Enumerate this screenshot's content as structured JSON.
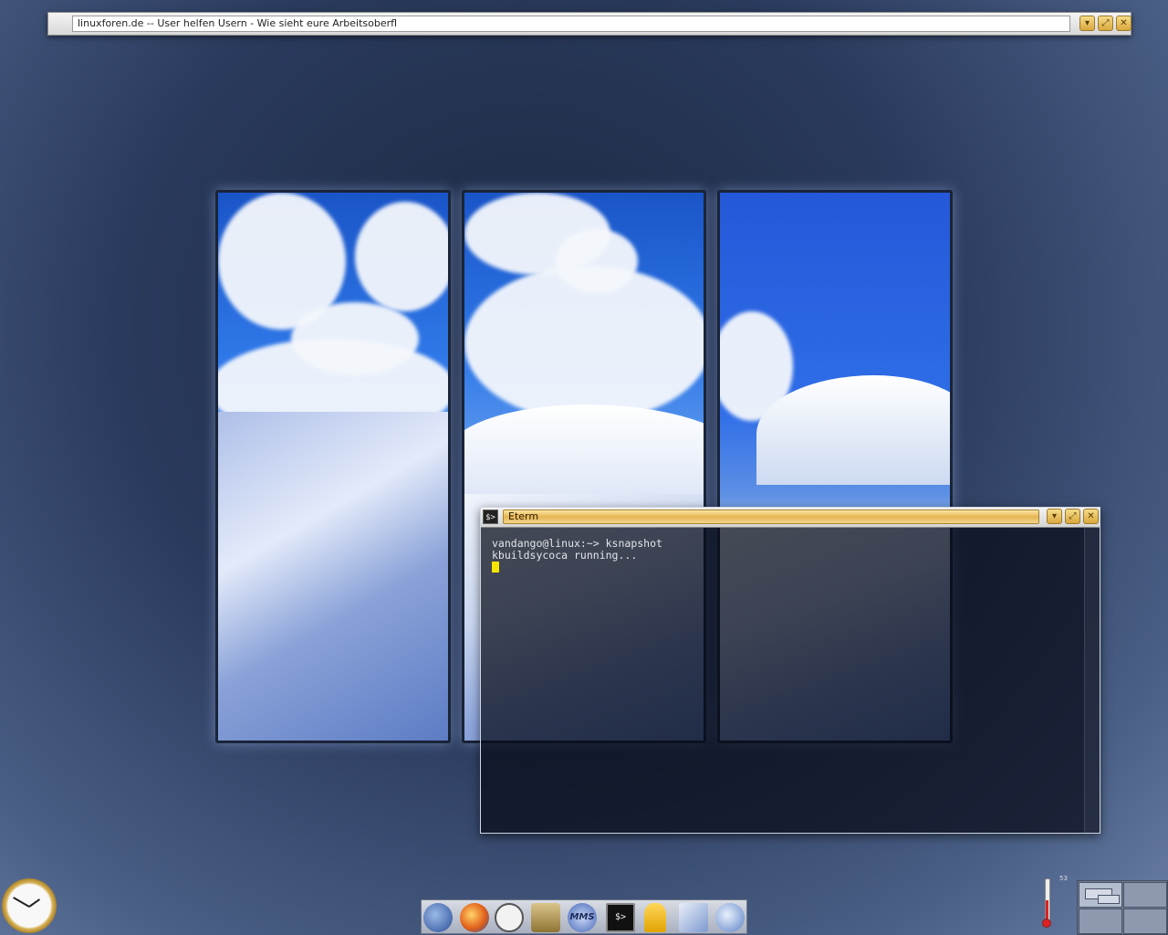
{
  "browser_window": {
    "title": "linuxforen.de -- User helfen Usern - Wie sieht eure Arbeitsoberfl",
    "minimize_icon": "chevron-down-icon",
    "maximize_icon": "maximize-icon",
    "close_icon": "close-icon"
  },
  "eterm_window": {
    "title": "Eterm",
    "app_icon_text": "$>",
    "lines": [
      "vandango@linux:~> ksnapshot",
      "kbuildsycoca running..."
    ],
    "cursor_color": "#f4e400"
  },
  "dock": {
    "items": [
      {
        "name": "thunderbird-icon"
      },
      {
        "name": "firefox-icon"
      },
      {
        "name": "clock-app-icon"
      },
      {
        "name": "gimp-icon"
      },
      {
        "name": "mms-icon",
        "label": "MMS"
      },
      {
        "name": "terminal-icon",
        "label": "$>"
      },
      {
        "name": "user-icon"
      },
      {
        "name": "editor-icon"
      },
      {
        "name": "settings-icon"
      }
    ]
  },
  "system_tray": {
    "temperature": "53",
    "pager_desktops": 4
  },
  "colors": {
    "title_gold": "#e6b552",
    "desktop_blue": "#2a3a5c"
  }
}
